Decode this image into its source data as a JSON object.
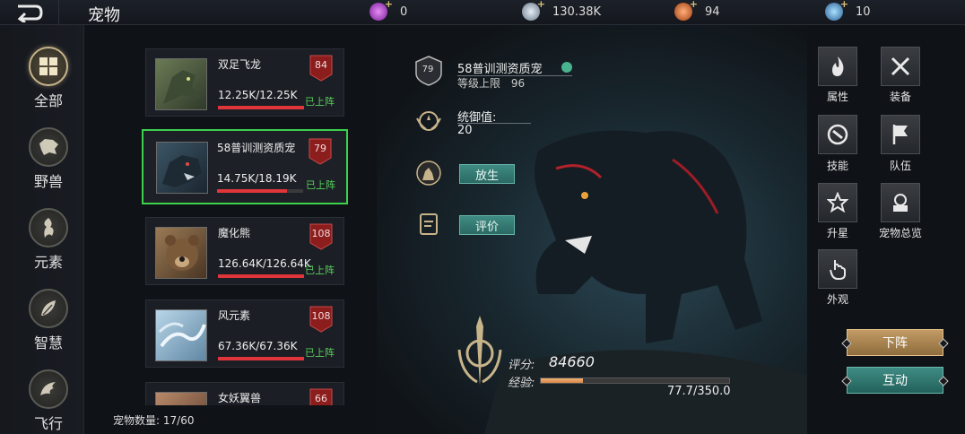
{
  "header": {
    "title": "宠物",
    "resources": [
      {
        "icon": "purple-gem-icon",
        "value": "0",
        "color": "#b44bd6"
      },
      {
        "icon": "silver-coin-icon",
        "value": "130.38K",
        "color": "#a8b6c4"
      },
      {
        "icon": "orange-orb-icon",
        "value": "94",
        "color": "#e0703a"
      },
      {
        "icon": "blue-orb-icon",
        "value": "10",
        "color": "#5aa7d9"
      }
    ]
  },
  "categories": [
    {
      "label": "全部",
      "icon": "grid-icon",
      "active": true
    },
    {
      "label": "野兽",
      "icon": "beast-head-icon",
      "active": false
    },
    {
      "label": "元素",
      "icon": "element-icon",
      "active": false
    },
    {
      "label": "智慧",
      "icon": "wisdom-leaf-icon",
      "active": false
    },
    {
      "label": "飞行",
      "icon": "wing-icon",
      "active": false
    }
  ],
  "pets": [
    {
      "name": "双足飞龙",
      "hp": "12.25K/12.25K",
      "hp_ratio": 1.0,
      "level": "84",
      "status": "已上阵",
      "thumb": "dragon"
    },
    {
      "name": "58普训测资质宠",
      "hp": "14.75K/18.19K",
      "hp_ratio": 0.81,
      "level": "79",
      "status": "已上阵",
      "thumb": "panther",
      "selected": true
    },
    {
      "name": "魔化熊",
      "hp": "126.64K/126.64K",
      "hp_ratio": 1.0,
      "level": "108",
      "status": "已上阵",
      "thumb": "bear"
    },
    {
      "name": "风元素",
      "hp": "67.36K/67.36K",
      "hp_ratio": 1.0,
      "level": "108",
      "status": "已上阵",
      "thumb": "wind"
    },
    {
      "name": "女妖翼兽",
      "level": "66",
      "thumb": "harpy"
    }
  ],
  "pet_count": {
    "label": "宠物数量:",
    "value": "17/60"
  },
  "detail": {
    "level_badge": "79",
    "name": "58普训测资质宠",
    "level_cap_label": "等级上限",
    "level_cap_value": "96",
    "command_label": "统御值:",
    "command_value": "20",
    "release_button": "放生",
    "rate_button": "评价",
    "score_label": "评分:",
    "score_value": "84660",
    "exp_label": "经验:",
    "exp_text": "77.7/350.0",
    "exp_ratio": 0.222
  },
  "functions": [
    {
      "label": "属性",
      "icon": "flame-icon"
    },
    {
      "label": "装备",
      "icon": "crossed-swords-icon"
    },
    {
      "label": "技能",
      "icon": "skill-icon"
    },
    {
      "label": "队伍",
      "icon": "flag-icon"
    },
    {
      "label": "升星",
      "icon": "star-icon"
    },
    {
      "label": "宠物总览",
      "icon": "overview-icon"
    },
    {
      "label": "外观",
      "icon": "hand-icon"
    }
  ],
  "actions": {
    "unassign": "下阵",
    "interact": "互动"
  },
  "colors": {
    "accent_gold": "#c8b48a",
    "hp_red": "#e0353a",
    "selected_green": "#3bd14b",
    "status_green": "#57d05b",
    "teal_button": "#3f8b83"
  }
}
